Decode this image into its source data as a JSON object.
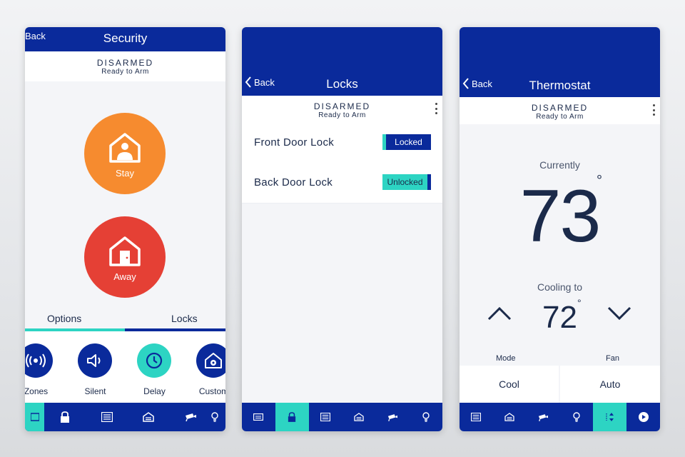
{
  "security": {
    "back_label": "Back",
    "title": "Security",
    "status": "DISARMED",
    "substatus": "Ready to Arm",
    "stay_label": "Stay",
    "away_label": "Away",
    "tabs": [
      "Options",
      "Locks"
    ],
    "options": [
      {
        "label": "Zones",
        "icon": "broadcast-icon"
      },
      {
        "label": "Silent",
        "icon": "speaker-icon"
      },
      {
        "label": "Delay",
        "icon": "clock-icon"
      },
      {
        "label": "Custom",
        "icon": "house-gear-icon"
      }
    ]
  },
  "locks": {
    "back_label": "Back",
    "title": "Locks",
    "status": "DISARMED",
    "substatus": "Ready to Arm",
    "items": [
      {
        "name": "Front Door Lock",
        "state": "Locked"
      },
      {
        "name": "Back Door Lock",
        "state": "Unlocked"
      }
    ]
  },
  "thermostat": {
    "back_label": "Back",
    "title": "Thermostat",
    "status": "DISARMED",
    "substatus": "Ready to Arm",
    "currently_label": "Currently",
    "current_temp": "73",
    "degree_symbol": "°",
    "cooling_label": "Cooling to",
    "target_temp": "72",
    "mode_label": "Mode",
    "fan_label": "Fan",
    "mode_value": "Cool",
    "fan_value": "Auto"
  },
  "colors": {
    "brand_blue": "#0a2a9b",
    "teal": "#2dd4c3",
    "stay_orange": "#f68b2f",
    "away_red": "#e54035"
  }
}
